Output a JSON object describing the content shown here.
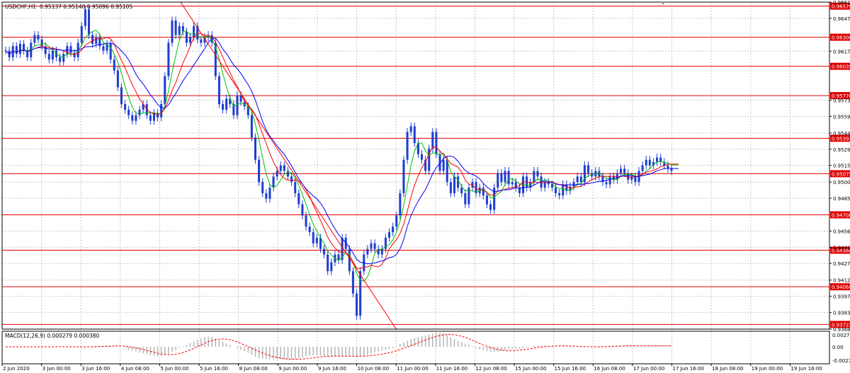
{
  "header": {
    "symbol": "USDCHF,H1",
    "ohlc": "0.95137 0.95140 0.95096 0.95105"
  },
  "macd": {
    "label": "MACD(12,26,9) 0.000279 0.000380"
  },
  "colors": {
    "background": "#ffffff",
    "grid": "#c8c8c8",
    "candle": "#1f3fd0",
    "level_line": "#e00000",
    "level_tag": "#e00000",
    "sma_fast": "#00c000",
    "sma_mid": "#ff0000",
    "sma_slow": "#0000ff",
    "trendline": "#ff0000",
    "macd_hist": "#b4b4b4",
    "macd_signal": "#ff0000"
  },
  "chart_data": {
    "type": "candlestick",
    "symbol": "USDCHF",
    "timeframe": "H1",
    "ylim": [
      0.9368,
      0.96615
    ],
    "y_ticks": [
      "0.96615",
      "0.96470",
      "0.96175",
      "0.95735",
      "0.95590",
      "0.95440",
      "0.95295",
      "0.95150",
      "0.95000",
      "0.94855",
      "0.94560",
      "0.94415",
      "0.94270",
      "0.94120",
      "0.93975",
      "0.93830",
      "0.93680"
    ],
    "x_ticks": [
      "2 Jun 2020",
      "3 Jun 00:00",
      "3 Jun 16:00",
      "4 Jun 08:00",
      "5 Jun 00:00",
      "5 Jun 16:00",
      "8 Jun 08:00",
      "9 Jun 00:00",
      "9 Jun 16:00",
      "10 Jun 08:00",
      "11 Jun 00:00",
      "11 Jun 16:00",
      "12 Jun 08:00",
      "15 Jun 00:00",
      "15 Jun 16:00",
      "16 Jun 08:00",
      "17 Jun 00:00",
      "17 Jun 16:00",
      "18 Jun 08:00",
      "19 Jun 00:00",
      "19 Jun 16:00"
    ],
    "horizontal_levels": [
      0.96579,
      0.963,
      0.96039,
      0.95776,
      0.95393,
      0.95075,
      0.94706,
      0.94388,
      0.9406,
      0.93722
    ],
    "horizontal_level_labels": [
      "0.96579",
      "0.96300",
      "0.96039",
      "0.95776",
      "0.95393",
      "0.95075",
      "0.94706",
      "0.94388",
      "0.94060",
      "0.93722"
    ],
    "series_close": [
      0.9618,
      0.9612,
      0.9622,
      0.9615,
      0.9624,
      0.9618,
      0.9612,
      0.9625,
      0.9632,
      0.9628,
      0.9622,
      0.9615,
      0.961,
      0.9618,
      0.9612,
      0.9608,
      0.9615,
      0.9622,
      0.9616,
      0.9612,
      0.9625,
      0.964,
      0.9655,
      0.9632,
      0.9624,
      0.963,
      0.9622,
      0.9618,
      0.9624,
      0.961,
      0.96,
      0.9585,
      0.957,
      0.9565,
      0.956,
      0.9555,
      0.956,
      0.9565,
      0.957,
      0.956,
      0.9555,
      0.9562,
      0.9558,
      0.957,
      0.9595,
      0.9625,
      0.9645,
      0.9632,
      0.964,
      0.9635,
      0.9625,
      0.963,
      0.964,
      0.9628,
      0.9625,
      0.963,
      0.9632,
      0.9625,
      0.9595,
      0.957,
      0.9565,
      0.9575,
      0.957,
      0.956,
      0.9578,
      0.9572,
      0.9568,
      0.956,
      0.954,
      0.952,
      0.95,
      0.949,
      0.9485,
      0.9495,
      0.9505,
      0.951,
      0.9515,
      0.951,
      0.9505,
      0.95,
      0.949,
      0.948,
      0.947,
      0.946,
      0.9455,
      0.9445,
      0.945,
      0.944,
      0.9435,
      0.942,
      0.9428,
      0.9435,
      0.943,
      0.945,
      0.944,
      0.942,
      0.94,
      0.938,
      0.942,
      0.9435,
      0.944,
      0.9445,
      0.944,
      0.9435,
      0.944,
      0.945,
      0.9455,
      0.946,
      0.947,
      0.949,
      0.952,
      0.9545,
      0.955,
      0.9535,
      0.9525,
      0.952,
      0.951,
      0.953,
      0.9545,
      0.9525,
      0.951,
      0.952,
      0.95,
      0.949,
      0.9505,
      0.9495,
      0.949,
      0.948,
      0.9495,
      0.95,
      0.949,
      0.9495,
      0.9488,
      0.948,
      0.9475,
      0.9495,
      0.9508,
      0.95,
      0.951,
      0.9498,
      0.95,
      0.9495,
      0.949,
      0.9505,
      0.9495,
      0.95,
      0.951,
      0.9505,
      0.9495,
      0.95,
      0.9498,
      0.9495,
      0.949,
      0.9488,
      0.9498,
      0.9492,
      0.9496,
      0.95,
      0.9505,
      0.95,
      0.9515,
      0.9508,
      0.9505,
      0.951,
      0.9505,
      0.95,
      0.9498,
      0.9505,
      0.9502,
      0.9508,
      0.9512,
      0.9508,
      0.9502,
      0.9505,
      0.95,
      0.951,
      0.9515,
      0.952,
      0.9515,
      0.9518,
      0.9522,
      0.9518,
      0.9515,
      0.9512,
      0.951
    ]
  }
}
